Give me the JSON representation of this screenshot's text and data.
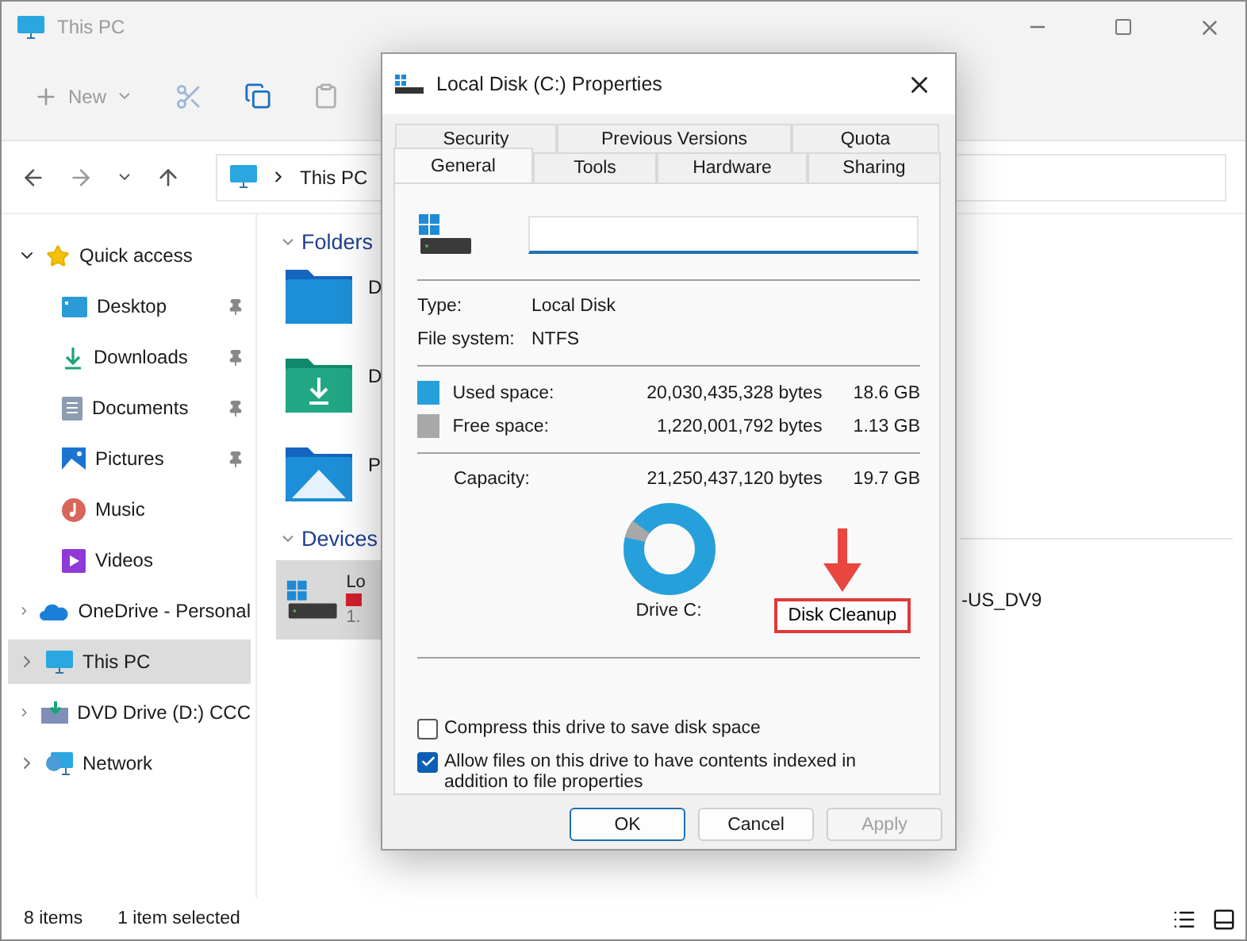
{
  "window": {
    "title": "This PC"
  },
  "toolbar": {
    "new_label": "New"
  },
  "address": {
    "path": "This PC"
  },
  "sidebar": [
    {
      "label": "Quick access",
      "expanded": true,
      "selected": false,
      "children": [
        {
          "label": "Desktop",
          "pinned": true,
          "selected": false
        },
        {
          "label": "Downloads",
          "pinned": true,
          "selected": false
        },
        {
          "label": "Documents",
          "pinned": true,
          "selected": false
        },
        {
          "label": "Pictures",
          "pinned": true,
          "selected": false
        },
        {
          "label": "Music",
          "pinned": false,
          "selected": false
        },
        {
          "label": "Videos",
          "pinned": false,
          "selected": false
        }
      ]
    },
    {
      "label": "OneDrive - Personal",
      "expanded": false,
      "selected": false
    },
    {
      "label": "This PC",
      "expanded": false,
      "selected": true
    },
    {
      "label": "DVD Drive (D:) CCC",
      "expanded": false,
      "selected": false
    },
    {
      "label": "Network",
      "expanded": false,
      "selected": false
    }
  ],
  "content": {
    "folders_heading": "Folders",
    "folders": [
      "D",
      "D",
      "P"
    ],
    "devices_heading": "Devices",
    "drive": {
      "name": "Lo",
      "free": "1.",
      "selected": true
    },
    "dvd_label": "-US_DV9"
  },
  "status_bar": {
    "count": "8 items",
    "selection": "1 item selected"
  },
  "dialog": {
    "title": "Local Disk (C:) Properties",
    "tabs_back": [
      {
        "label": "Security",
        "selected": false
      },
      {
        "label": "Previous Versions",
        "selected": false
      },
      {
        "label": "Quota",
        "selected": false
      }
    ],
    "tabs_front": [
      {
        "label": "General",
        "selected": true
      },
      {
        "label": "Tools",
        "selected": false
      },
      {
        "label": "Hardware",
        "selected": false
      },
      {
        "label": "Sharing",
        "selected": false
      }
    ],
    "type_label": "Type:",
    "type_value": "Local Disk",
    "fs_label": "File system:",
    "fs_value": "NTFS",
    "space": [
      {
        "label": "Used space:",
        "bytes": "20,030,435,328 bytes",
        "size": "18.6 GB",
        "color": "#26a0da"
      },
      {
        "label": "Free space:",
        "bytes": "1,220,001,792 bytes",
        "size": "1.13 GB",
        "color": "#a8a8a8"
      }
    ],
    "capacity": {
      "label": "Capacity:",
      "bytes": "21,250,437,120 bytes",
      "size": "19.7 GB"
    },
    "drive_label": "Drive C:",
    "cleanup": {
      "label": "Disk Cleanup",
      "highlighted": true
    },
    "options": [
      {
        "label": "Compress this drive to save disk space",
        "checked": false
      },
      {
        "label": "Allow files on this drive to have contents indexed in addition to file properties",
        "checked": true
      }
    ],
    "buttons": [
      {
        "label": "OK",
        "default": true,
        "disabled": false
      },
      {
        "label": "Cancel",
        "default": false,
        "disabled": false
      },
      {
        "label": "Apply",
        "default": false,
        "disabled": true
      }
    ]
  }
}
